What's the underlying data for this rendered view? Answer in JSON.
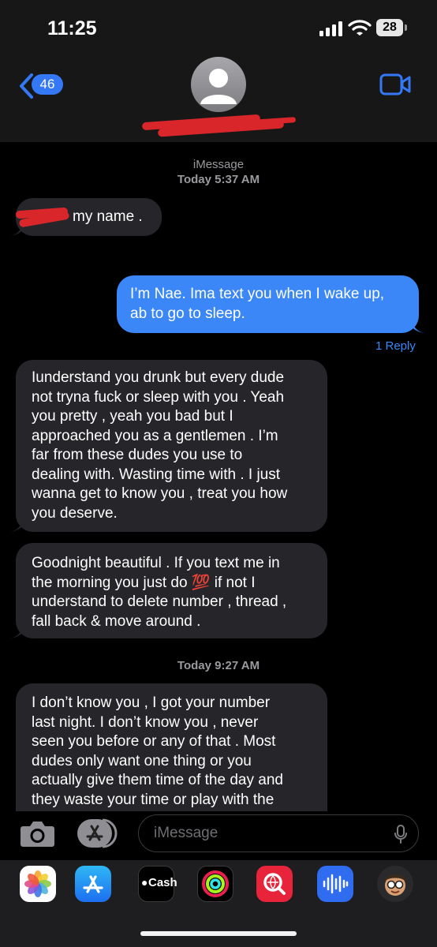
{
  "status": {
    "time": "11:25",
    "battery": "28"
  },
  "header": {
    "back_count": "46",
    "contact_name": ""
  },
  "conversation": {
    "service_label": "iMessage",
    "first_timestamp": "Today 5:37 AM",
    "second_timestamp": "Today 9:27 AM",
    "reply_link": "1 Reply",
    "messages": [
      {
        "direction": "incoming",
        "text": "my name ."
      },
      {
        "direction": "outgoing",
        "lines": [
          "I’m Nae. Ima text you when I wake up,",
          "ab to go to sleep."
        ]
      },
      {
        "direction": "incoming",
        "lines": [
          "Iunderstand you drunk but every dude",
          "not tryna fuck or sleep with you . Yeah",
          "you pretty , yeah you bad but I",
          "approached you as a gentlemen . I’m",
          "far from these dudes you use to",
          "dealing with. Wasting time with . I just",
          "wanna get to know you , treat you how",
          "you deserve."
        ]
      },
      {
        "direction": "incoming",
        "lines": [
          "Goodnight beautiful . If you text me in",
          "the morning you just do",
          "💯",
          "if not I",
          "understand to delete number , thread ,",
          "fall back & move around ."
        ]
      },
      {
        "direction": "incoming",
        "lines": [
          "I don’t know you , I got your number",
          "last night. I don’t know you , never",
          "seen you before or any of that . Most",
          "dudes only want one thing or you",
          "actually give them time of the day and",
          "they waste your time or play with the"
        ]
      }
    ]
  },
  "composer": {
    "placeholder": "iMessage"
  },
  "app_drawer": [
    {
      "name": "photos-icon"
    },
    {
      "name": "app-store-icon"
    },
    {
      "name": "apple-cash",
      "label": "Cash"
    },
    {
      "name": "activity-icon"
    },
    {
      "name": "search-images-icon"
    },
    {
      "name": "audio-message-icon"
    },
    {
      "name": "memoji-icon"
    }
  ],
  "colors": {
    "outgoing_bubble": "#3b87f7",
    "incoming_bubble": "#26262a",
    "redaction": "#d9262a"
  }
}
